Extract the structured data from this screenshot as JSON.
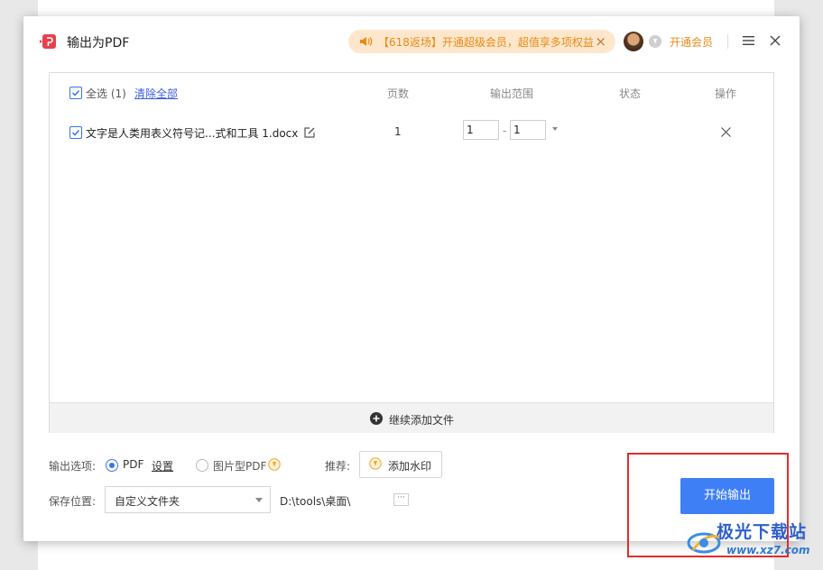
{
  "dialog": {
    "title": "输出为PDF",
    "promo_text": "【618返场】开通超级会员，超值享多项权益",
    "vip_label": "开通会员"
  },
  "file_list": {
    "header": {
      "select_all": "全选 (1)",
      "clear_all": "清除全部",
      "pages": "页数",
      "range": "输出范围",
      "status": "状态",
      "action": "操作"
    },
    "rows": [
      {
        "checked": true,
        "name": "文字是人类用表义符号记...式和工具 1.docx",
        "pages": "1",
        "range_from": "1",
        "range_to": "1",
        "status": ""
      }
    ],
    "add_more": "继续添加文件"
  },
  "options": {
    "label": "输出选项:",
    "pdf": "PDF",
    "settings": "设置",
    "image_pdf": "图片型PDF",
    "selected": "PDF",
    "recommend_label": "推荐:",
    "watermark_button": "添加水印"
  },
  "save": {
    "label": "保存位置:",
    "folder_option": "自定义文件夹",
    "path": "D:\\tools\\桌面\\",
    "more": "···"
  },
  "start_button": "开始输出",
  "watermark_brand": {
    "title": "极光下载站",
    "url": "www.xz7.com"
  },
  "colors": {
    "accent": "#3f7ff5",
    "promo_bg": "#fde7cc",
    "promo_text": "#e98a15",
    "highlight_box": "#e32b2b"
  },
  "icons": [
    "pdf-app-icon",
    "speaker-icon",
    "close-icon",
    "avatar",
    "coin-icon",
    "menu-icon",
    "edit-icon",
    "delete-icon",
    "add-circle-icon",
    "vip-badge-icon",
    "watermark-icon",
    "chevron-down-icon"
  ]
}
